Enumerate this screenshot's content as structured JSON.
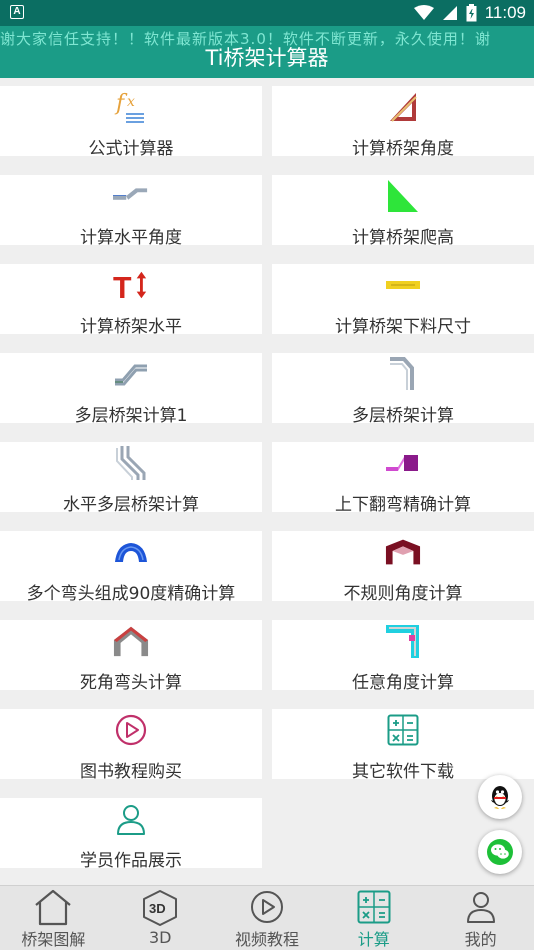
{
  "status_bar": {
    "time": "11:09",
    "app_badge": "A"
  },
  "header": {
    "marquee": "谢大家信任支持！！软件最新版本3.0！软件不断更新，永久使用！谢",
    "title": "Ti桥架计算器"
  },
  "grid": [
    {
      "label": "公式计算器",
      "icon": "formula-fx-icon"
    },
    {
      "label": "计算桥架角度",
      "icon": "triangle-ruler-icon"
    },
    {
      "label": "计算水平角度",
      "icon": "horizontal-angle-icon"
    },
    {
      "label": "计算桥架爬高",
      "icon": "green-triangle-icon"
    },
    {
      "label": "计算桥架水平",
      "icon": "t-arrows-icon"
    },
    {
      "label": "计算桥架下料尺寸",
      "icon": "yellow-bar-icon"
    },
    {
      "label": "多层桥架计算1",
      "icon": "stairs-tray-icon"
    },
    {
      "label": "多层桥架计算",
      "icon": "bend-tray-icon"
    },
    {
      "label": "水平多层桥架计算",
      "icon": "multi-bend-icon"
    },
    {
      "label": "上下翻弯精确计算",
      "icon": "purple-step-icon"
    },
    {
      "label": "多个弯头组成90度精确计算",
      "icon": "blue-arc-icon"
    },
    {
      "label": "不规则角度计算",
      "icon": "maroon-tunnel-icon"
    },
    {
      "label": "死角弯头计算",
      "icon": "roof-bend-icon"
    },
    {
      "label": "任意角度计算",
      "icon": "cyan-corner-icon"
    },
    {
      "label": "图书教程购买",
      "icon": "play-circle-icon"
    },
    {
      "label": "其它软件下载",
      "icon": "calculator-icon"
    },
    {
      "label": "学员作品展示",
      "icon": "person-icon"
    }
  ],
  "bottom_nav": [
    {
      "label": "桥架图解",
      "icon": "home-icon"
    },
    {
      "label": "3D",
      "icon": "3d-cube-icon"
    },
    {
      "label": "视频教程",
      "icon": "video-play-icon"
    },
    {
      "label": "计算",
      "icon": "calculator-icon",
      "active": true
    },
    {
      "label": "我的",
      "icon": "profile-icon"
    }
  ],
  "colors": {
    "primary": "#1b9c87",
    "status_bar": "#0b6e62",
    "text": "#333333"
  }
}
